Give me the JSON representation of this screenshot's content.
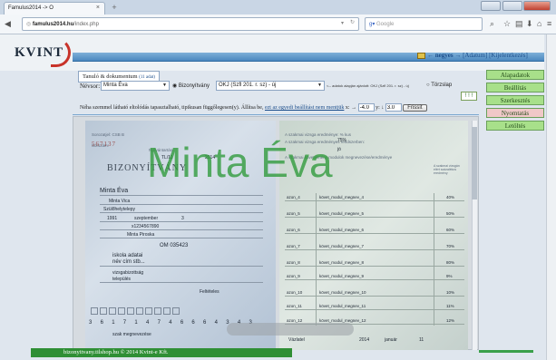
{
  "browser": {
    "tab_title": "Famulus2014 -> O",
    "tab_close": "×",
    "new_tab": "+",
    "url_host": "famulus2014.hu",
    "url_path": "/index.php",
    "search_placeholder": "Google"
  },
  "header": {
    "logo": "KVINT",
    "negyes": "← negyes →",
    "adatum": "[Adatum]",
    "kijelentkezes": "[Kijelentkezés]"
  },
  "filters": {
    "tab_label": "Tanuló & dokumentum",
    "tab_count": "(11 adat)",
    "nevsor_label": "Névsor:",
    "nevsor_value": "Minta Éva",
    "radio_bizonyitvany": "Bizonyítvány",
    "okj_value": "OKJ (Szfl 201. r. sz) - új",
    "adat_note": "<-- adatok alapján ajánlott: OKJ (Szfl 201. r. sz) - új",
    "radio_torzslap": "Törzslap",
    "exc_button": "! ! !",
    "offset_text": "Néha szemmel látható eltolódás tapasztalható, tipikusan függőlegesen(y). Állítsa be,",
    "offset_link": "ezt az egyedi beállítást nem mentjük",
    "x_label": "x:",
    "x_arrow": "→",
    "x_value": "-4.0",
    "y_label": "y:",
    "y_arrow": "↓",
    "y_value": "3.0",
    "refresh": "Frissít"
  },
  "menu": [
    {
      "label": "Alapadatok",
      "bg": "#a8e08a"
    },
    {
      "label": "Beállítás",
      "bg": "#a8e08a"
    },
    {
      "label": "Szerkesztés",
      "bg": "#a8e08a"
    },
    {
      "label": "Nyomtatás",
      "bg": "#f0c8c8"
    },
    {
      "label": "Letöltés",
      "bg": "#a8e08a"
    }
  ],
  "certificate": {
    "watermark": "Minta Éva",
    "reg_label": "Sorozatjel: CSB B",
    "reg_number": "567137",
    "serial_label": "Sorszám:",
    "nyilvantartasi": "Nyilvántartási",
    "tl_code": "TL/11",
    "year": "2014",
    "title": "BIZONYÍTVÁNY",
    "name": "Minta Éva",
    "birth_place": "Minta Vica",
    "town": "Szülőhelytelepy",
    "birth_year": "1991",
    "birth_month": "szeptember",
    "birth_day": "3",
    "id_number": "x1234567890",
    "mother": "Minta Piroska",
    "okj_number": "OM 035423",
    "school": "iskola adatai",
    "school2": "név cím stb...",
    "exam_type": "vizsgabizottság",
    "exam_city": "település",
    "grade_word": "Feltételes",
    "digits": "3 6 1 7 1 4 7 4 6 6 6 4 3 4 3",
    "oktatasi": "szak megnevezése",
    "right_top1": "A szakmai vizsga eredménye: % kus",
    "right_top2": "A szakmai vizsga eredményes rendszerben:",
    "right_pct": "75%",
    "right_jo": "jó",
    "right_top3": "A szakmai követelmény modulok megnevezése/eredménye",
    "col_pct_head": "A szakmai vizsgán elért százalékos eredmény",
    "rows": [
      {
        "code": "azon_4",
        "name": "követ_modul_megnev_4",
        "pct": "40%"
      },
      {
        "code": "azon_5",
        "name": "követ_modul_megnev_5",
        "pct": "50%"
      },
      {
        "code": "azon_6",
        "name": "követ_modul_megnev_6",
        "pct": "60%"
      },
      {
        "code": "azon_7",
        "name": "követ_modul_megnev_7",
        "pct": "70%"
      },
      {
        "code": "azon_8",
        "name": "követ_modul_megnev_8",
        "pct": "80%"
      },
      {
        "code": "azon_9",
        "name": "követ_modul_megnev_9",
        "pct": "9%"
      },
      {
        "code": "azon_10",
        "name": "követ_modul_megnev_10",
        "pct": "10%"
      },
      {
        "code": "azon_11",
        "name": "követ_modul_megnev_11",
        "pct": "11%"
      },
      {
        "code": "azon_12",
        "name": "követ_modul_megnev_12",
        "pct": "12%"
      }
    ],
    "bottom_city": "Vázlatel",
    "bottom_year": "2014",
    "bottom_month": "január",
    "bottom_day": "11"
  },
  "footer": {
    "text": "bizonyitvany.tilshop.hu © 2014 Kvint-e Kft."
  }
}
